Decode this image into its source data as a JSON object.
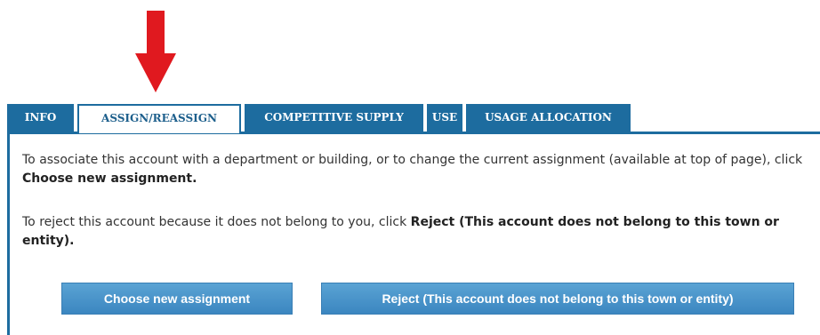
{
  "annotation": {
    "arrow_color": "#e0191f"
  },
  "tabs": [
    {
      "label": "INFO",
      "active": false
    },
    {
      "label": "ASSIGN/REASSIGN",
      "active": true
    },
    {
      "label": "COMPETITIVE SUPPLY",
      "active": false
    },
    {
      "label": "USE",
      "active": false
    },
    {
      "label": "USAGE ALLOCATION",
      "active": false
    }
  ],
  "panel": {
    "para1_text": "To associate this account with a department or building, or to change the current assignment (available at top of page), click ",
    "para1_bold": "Choose new assignment.",
    "para2_text": "To reject this account because it does not belong to you, click ",
    "para2_bold": "Reject (This account does not belong to this town or entity)."
  },
  "buttons": {
    "choose_label": "Choose new assignment",
    "reject_label": "Reject (This account does not belong to this town or entity)"
  },
  "colors": {
    "tab_blue": "#1d6c9f",
    "button_blue": "#4a95cb"
  }
}
